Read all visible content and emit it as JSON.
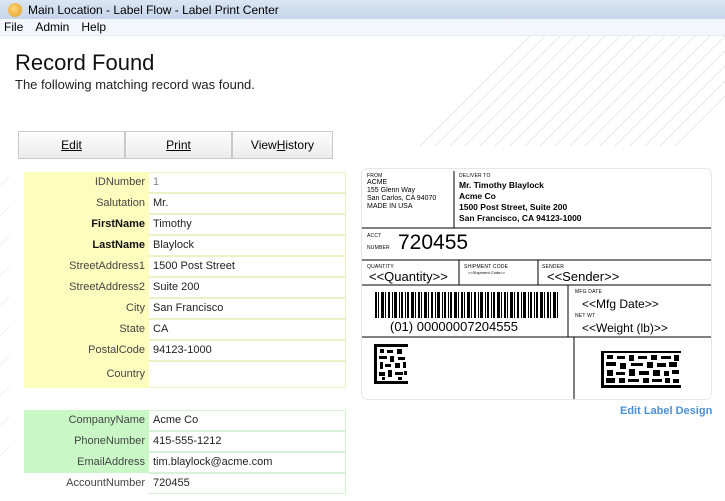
{
  "window": {
    "title": "Main Location - Label Flow - Label Print Center"
  },
  "menu": [
    "File",
    "Admin",
    "Help"
  ],
  "header": {
    "title": "Record Found",
    "subtitle": "The following matching record was found."
  },
  "toolbar": {
    "edit": "Edit",
    "print": "Print",
    "view_history_prefix": "View ",
    "view_history_access": "H",
    "view_history_suffix": "istory"
  },
  "record": [
    {
      "label": "IDNumber",
      "value": "1",
      "bold": false,
      "grey": true
    },
    {
      "label": "Salutation",
      "value": "Mr.",
      "bold": false,
      "grey": false
    },
    {
      "label": "FirstName",
      "value": "Timothy",
      "bold": true,
      "grey": false
    },
    {
      "label": "LastName",
      "value": "Blaylock",
      "bold": true,
      "grey": false
    },
    {
      "label": "StreetAddress1",
      "value": "1500 Post Street",
      "bold": false,
      "grey": false
    },
    {
      "label": "StreetAddress2",
      "value": "Suite 200",
      "bold": false,
      "grey": false
    },
    {
      "label": "City",
      "value": "San Francisco",
      "bold": false,
      "grey": false
    },
    {
      "label": "State",
      "value": "CA",
      "bold": false,
      "grey": false
    },
    {
      "label": "PostalCode",
      "value": "94123-1000",
      "bold": false,
      "grey": false
    },
    {
      "label": "Country",
      "value": "",
      "bold": false,
      "grey": false
    }
  ],
  "company": [
    {
      "label": "CompanyName",
      "value": "Acme Co"
    },
    {
      "label": "PhoneNumber",
      "value": "415-555-1212"
    },
    {
      "label": "EmailAddress",
      "value": "tim.blaylock@acme.com"
    },
    {
      "label": "AccountNumber",
      "value": "720455"
    }
  ],
  "label": {
    "from_title": "FROM",
    "from_lines": [
      "ACME",
      "155 Glenn Way",
      "San Carlos, CA 94070",
      "MADE IN USA"
    ],
    "deliver_title": "DELIVER TO",
    "deliver_lines": [
      "Mr. Timothy Blaylock",
      "Acme Co",
      "1500 Post Street, Suite 200",
      "San Francisco, CA  94123-1000"
    ],
    "acct_title1": "ACCT",
    "acct_title2": "NUMBER",
    "acct_number": "720455",
    "qty_title": "QUANTITY",
    "qty_value": "<<Quantity>>",
    "ship_title": "SHIPMENT CODE",
    "ship_value": "<<Shipment Code>>",
    "sender_title": "SENDER",
    "sender_value": "<<Sender>>",
    "barcode_text": "(01) 00000007204555",
    "mfg_title": "MFG DATE",
    "mfg_value": "<<Mfg Date>>",
    "wt_title": "NET WT",
    "wt_value": "<<Weight (lb)>>"
  },
  "edit_label_link": "Edit Label Design"
}
